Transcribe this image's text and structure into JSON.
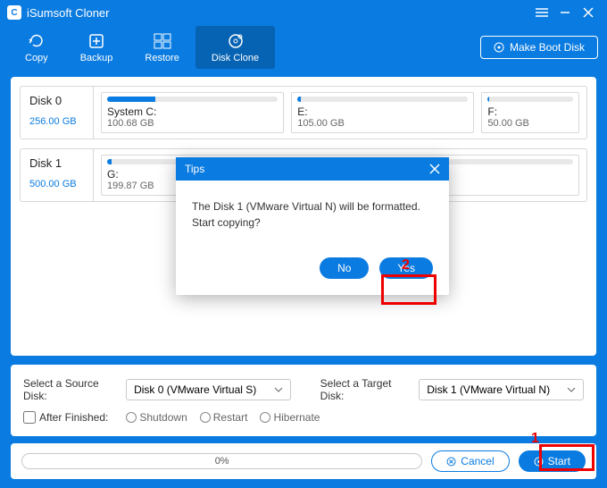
{
  "app": {
    "title": "iSumsoft Cloner"
  },
  "toolbar": {
    "copy": "Copy",
    "backup": "Backup",
    "restore": "Restore",
    "diskclone": "Disk Clone",
    "bootdisk": "Make Boot Disk"
  },
  "disks": [
    {
      "name": "Disk 0",
      "size": "256.00 GB",
      "parts": [
        {
          "name": "System C:",
          "size": "100.68 GB",
          "fill": 28
        },
        {
          "name": "E:",
          "size": "105.00 GB",
          "fill": 2
        },
        {
          "name": "F:",
          "size": "50.00 GB",
          "fill": 2
        }
      ]
    },
    {
      "name": "Disk 1",
      "size": "500.00 GB",
      "parts": [
        {
          "name": "G:",
          "size": "199.87 GB",
          "fill": 1
        }
      ]
    }
  ],
  "controls": {
    "source_label": "Select a Source Disk:",
    "source_value": "Disk 0 (VMware Virtual S)",
    "target_label": "Select a Target Disk:",
    "target_value": "Disk 1 (VMware Virtual N)",
    "after_label": "After Finished:",
    "radios": [
      "Shutdown",
      "Restart",
      "Hibernate"
    ]
  },
  "footer": {
    "progress": "0%",
    "cancel": "Cancel",
    "start": "Start"
  },
  "dialog": {
    "title": "Tips",
    "body": "The Disk 1 (VMware Virtual N) will be formatted. Start copying?",
    "no": "No",
    "yes": "Yes"
  },
  "callouts": {
    "one": "1",
    "two": "2"
  }
}
